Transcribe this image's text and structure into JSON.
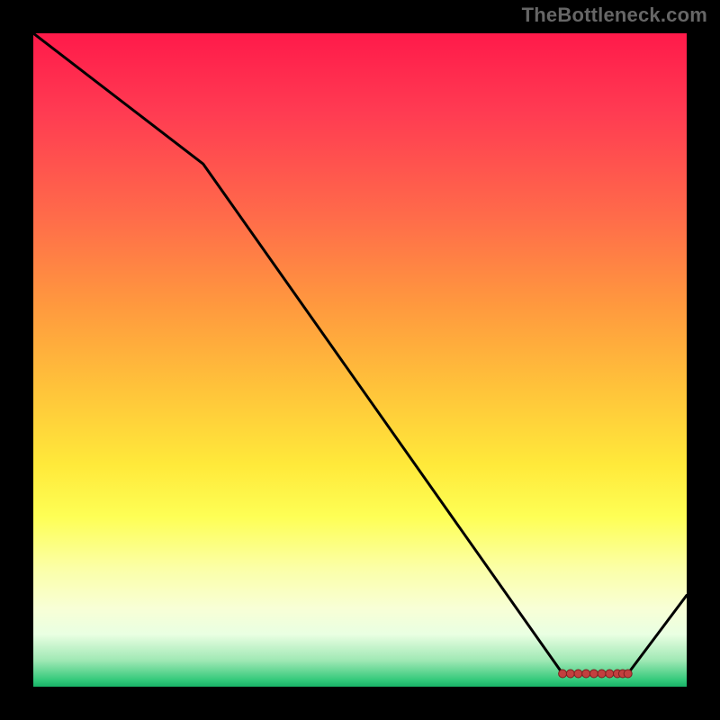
{
  "watermark": "TheBottleneck.com",
  "chart_data": {
    "type": "line",
    "title": "",
    "xlabel": "",
    "ylabel": "",
    "xlim": [
      0,
      100
    ],
    "ylim": [
      0,
      100
    ],
    "x": [
      0,
      26,
      81,
      91,
      100
    ],
    "values": [
      100,
      80,
      2,
      2,
      14
    ],
    "flat_region": {
      "x_start": 81,
      "x_end": 91,
      "y": 2
    },
    "flat_marker_x": [
      81,
      82.2,
      83.4,
      84.6,
      85.8,
      87.0,
      88.2,
      89.4,
      90.2,
      91
    ],
    "gradient_stops": [
      {
        "pct": 0,
        "color": "#ff1a4a"
      },
      {
        "pct": 12,
        "color": "#ff3b52"
      },
      {
        "pct": 28,
        "color": "#ff6b4a"
      },
      {
        "pct": 42,
        "color": "#ff9a3e"
      },
      {
        "pct": 55,
        "color": "#ffc53a"
      },
      {
        "pct": 66,
        "color": "#ffe93a"
      },
      {
        "pct": 74,
        "color": "#feff55"
      },
      {
        "pct": 82,
        "color": "#fbffa8"
      },
      {
        "pct": 88,
        "color": "#f8ffd6"
      },
      {
        "pct": 92,
        "color": "#e9ffe2"
      },
      {
        "pct": 96,
        "color": "#9fe8b4"
      },
      {
        "pct": 99,
        "color": "#33c97a"
      },
      {
        "pct": 100,
        "color": "#18b267"
      }
    ],
    "line_color": "#000000",
    "marker_fill": "#c33f3f",
    "marker_stroke": "#7a1f1f"
  }
}
